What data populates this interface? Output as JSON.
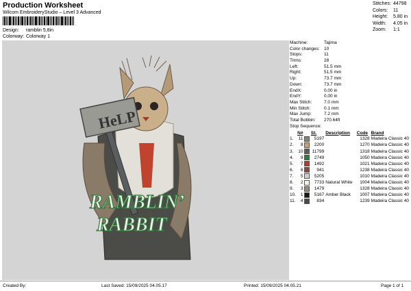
{
  "header": {
    "title": "Production Worksheet",
    "subtitle": "Wilcom EmbroideryStudio – Level 3 Advanced",
    "design_label": "Design:",
    "design_value": "ramblin 5,8in",
    "colorway_label": "Colorway:",
    "colorway_value": "Colorway 1"
  },
  "stats": [
    {
      "label": "Stitches:",
      "value": "44798"
    },
    {
      "label": "Colors:",
      "value": "11"
    },
    {
      "label": "Height:",
      "value": "5.80 in"
    },
    {
      "label": "Width:",
      "value": "4.05 in"
    },
    {
      "label": "Zoom:",
      "value": "1:1"
    }
  ],
  "artwork": {
    "sign_text": "HeLP",
    "line1": "RAMBLIN’",
    "line2": "RABBIT"
  },
  "machine": [
    {
      "label": "Machine:",
      "value": "Tajima"
    },
    {
      "label": "Color changes:",
      "value": "10"
    },
    {
      "label": "Stops:",
      "value": "11"
    },
    {
      "label": "Trims:",
      "value": "28"
    },
    {
      "label": "Left:",
      "value": "51.5 mm"
    },
    {
      "label": "Right:",
      "value": "51.5 mm"
    },
    {
      "label": "Up:",
      "value": "73.7 mm"
    },
    {
      "label": "Down:",
      "value": "73.7 mm"
    },
    {
      "label": "EndX:",
      "value": "0.00 in"
    },
    {
      "label": "EndY:",
      "value": "0.00 in"
    },
    {
      "label": "Max Stitch:",
      "value": "7.0 mm"
    },
    {
      "label": "Min Stitch:",
      "value": "0.1 mm"
    },
    {
      "label": "Max Jump:",
      "value": "7.2 mm"
    },
    {
      "label": "Total Bobbin:",
      "value": "270.64ft"
    }
  ],
  "stop_sequence": {
    "label": "Stop Sequence:",
    "headers": {
      "n": "N#",
      "st": "St.",
      "desc": "Description",
      "code": "Code",
      "brand": "Brand"
    },
    "rows": [
      {
        "idx": "1.",
        "n": "11",
        "color": "#8b8276",
        "st": "5197",
        "desc": "",
        "code": "1328",
        "brand": "Madeira Classic 40"
      },
      {
        "idx": "2.",
        "n": "8",
        "color": "#c9a36b",
        "st": "2200",
        "desc": "",
        "code": "1270",
        "brand": "Madeira Classic 40"
      },
      {
        "idx": "3.",
        "n": "10",
        "color": "#5b5e60",
        "st": "11799",
        "desc": "",
        "code": "1318",
        "brand": "Madeira Classic 40"
      },
      {
        "idx": "4.",
        "n": "9",
        "color": "#2f7d3a",
        "st": "2749",
        "desc": "",
        "code": "1050",
        "brand": "Madeira Classic 40"
      },
      {
        "idx": "5.",
        "n": "7",
        "color": "#b23a2a",
        "st": "1492",
        "desc": "",
        "code": "1021",
        "brand": "Madeira Classic 40"
      },
      {
        "idx": "6.",
        "n": "6",
        "color": "#8a4a3a",
        "st": "941",
        "desc": "",
        "code": "1238",
        "brand": "Madeira Classic 40"
      },
      {
        "idx": "7.",
        "n": "5",
        "color": "#cfcfcf",
        "st": "5205",
        "desc": "",
        "code": "1010",
        "brand": "Madeira Classic 40"
      },
      {
        "idx": "8.",
        "n": "2",
        "color": "#f4f1e6",
        "st": "7733",
        "desc": "Natural White",
        "code": "1004",
        "brand": "Madeira Classic 40"
      },
      {
        "idx": "9.",
        "n": "3",
        "color": "#9a8a7a",
        "st": "1479",
        "desc": "",
        "code": "1328",
        "brand": "Madeira Classic 40"
      },
      {
        "idx": "10.",
        "n": "1",
        "color": "#1a1a1a",
        "st": "5167",
        "desc": "Amber Black",
        "code": "1007",
        "brand": "Madeira Classic 40"
      },
      {
        "idx": "11.",
        "n": "4",
        "color": "#4a4a4a",
        "st": "834",
        "desc": "",
        "code": "1239",
        "brand": "Madeira Classic 40"
      }
    ]
  },
  "footer": {
    "created_by": "Created By:",
    "last_saved": "Last Saved: 15/09/2025 04.05.17",
    "printed": "Printed: 15/09/2025 04.05.21",
    "page": "Page 1 of 1"
  }
}
